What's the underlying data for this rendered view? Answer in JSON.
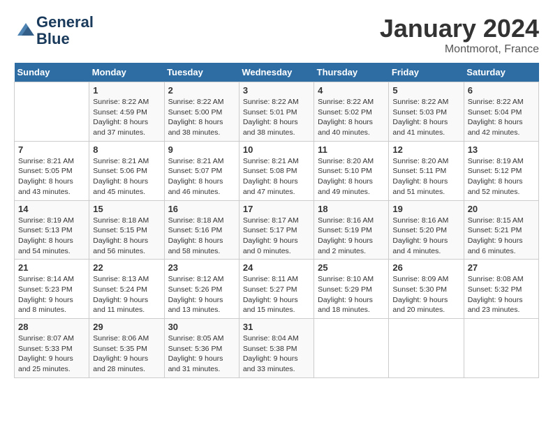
{
  "header": {
    "logo_line1": "General",
    "logo_line2": "Blue",
    "month_title": "January 2024",
    "location": "Montmorot, France"
  },
  "weekdays": [
    "Sunday",
    "Monday",
    "Tuesday",
    "Wednesday",
    "Thursday",
    "Friday",
    "Saturday"
  ],
  "weeks": [
    [
      {
        "day": "",
        "sunrise": "",
        "sunset": "",
        "daylight": ""
      },
      {
        "day": "1",
        "sunrise": "Sunrise: 8:22 AM",
        "sunset": "Sunset: 4:59 PM",
        "daylight": "Daylight: 8 hours and 37 minutes."
      },
      {
        "day": "2",
        "sunrise": "Sunrise: 8:22 AM",
        "sunset": "Sunset: 5:00 PM",
        "daylight": "Daylight: 8 hours and 38 minutes."
      },
      {
        "day": "3",
        "sunrise": "Sunrise: 8:22 AM",
        "sunset": "Sunset: 5:01 PM",
        "daylight": "Daylight: 8 hours and 38 minutes."
      },
      {
        "day": "4",
        "sunrise": "Sunrise: 8:22 AM",
        "sunset": "Sunset: 5:02 PM",
        "daylight": "Daylight: 8 hours and 40 minutes."
      },
      {
        "day": "5",
        "sunrise": "Sunrise: 8:22 AM",
        "sunset": "Sunset: 5:03 PM",
        "daylight": "Daylight: 8 hours and 41 minutes."
      },
      {
        "day": "6",
        "sunrise": "Sunrise: 8:22 AM",
        "sunset": "Sunset: 5:04 PM",
        "daylight": "Daylight: 8 hours and 42 minutes."
      }
    ],
    [
      {
        "day": "7",
        "sunrise": "Sunrise: 8:21 AM",
        "sunset": "Sunset: 5:05 PM",
        "daylight": "Daylight: 8 hours and 43 minutes."
      },
      {
        "day": "8",
        "sunrise": "Sunrise: 8:21 AM",
        "sunset": "Sunset: 5:06 PM",
        "daylight": "Daylight: 8 hours and 45 minutes."
      },
      {
        "day": "9",
        "sunrise": "Sunrise: 8:21 AM",
        "sunset": "Sunset: 5:07 PM",
        "daylight": "Daylight: 8 hours and 46 minutes."
      },
      {
        "day": "10",
        "sunrise": "Sunrise: 8:21 AM",
        "sunset": "Sunset: 5:08 PM",
        "daylight": "Daylight: 8 hours and 47 minutes."
      },
      {
        "day": "11",
        "sunrise": "Sunrise: 8:20 AM",
        "sunset": "Sunset: 5:10 PM",
        "daylight": "Daylight: 8 hours and 49 minutes."
      },
      {
        "day": "12",
        "sunrise": "Sunrise: 8:20 AM",
        "sunset": "Sunset: 5:11 PM",
        "daylight": "Daylight: 8 hours and 51 minutes."
      },
      {
        "day": "13",
        "sunrise": "Sunrise: 8:19 AM",
        "sunset": "Sunset: 5:12 PM",
        "daylight": "Daylight: 8 hours and 52 minutes."
      }
    ],
    [
      {
        "day": "14",
        "sunrise": "Sunrise: 8:19 AM",
        "sunset": "Sunset: 5:13 PM",
        "daylight": "Daylight: 8 hours and 54 minutes."
      },
      {
        "day": "15",
        "sunrise": "Sunrise: 8:18 AM",
        "sunset": "Sunset: 5:15 PM",
        "daylight": "Daylight: 8 hours and 56 minutes."
      },
      {
        "day": "16",
        "sunrise": "Sunrise: 8:18 AM",
        "sunset": "Sunset: 5:16 PM",
        "daylight": "Daylight: 8 hours and 58 minutes."
      },
      {
        "day": "17",
        "sunrise": "Sunrise: 8:17 AM",
        "sunset": "Sunset: 5:17 PM",
        "daylight": "Daylight: 9 hours and 0 minutes."
      },
      {
        "day": "18",
        "sunrise": "Sunrise: 8:16 AM",
        "sunset": "Sunset: 5:19 PM",
        "daylight": "Daylight: 9 hours and 2 minutes."
      },
      {
        "day": "19",
        "sunrise": "Sunrise: 8:16 AM",
        "sunset": "Sunset: 5:20 PM",
        "daylight": "Daylight: 9 hours and 4 minutes."
      },
      {
        "day": "20",
        "sunrise": "Sunrise: 8:15 AM",
        "sunset": "Sunset: 5:21 PM",
        "daylight": "Daylight: 9 hours and 6 minutes."
      }
    ],
    [
      {
        "day": "21",
        "sunrise": "Sunrise: 8:14 AM",
        "sunset": "Sunset: 5:23 PM",
        "daylight": "Daylight: 9 hours and 8 minutes."
      },
      {
        "day": "22",
        "sunrise": "Sunrise: 8:13 AM",
        "sunset": "Sunset: 5:24 PM",
        "daylight": "Daylight: 9 hours and 11 minutes."
      },
      {
        "day": "23",
        "sunrise": "Sunrise: 8:12 AM",
        "sunset": "Sunset: 5:26 PM",
        "daylight": "Daylight: 9 hours and 13 minutes."
      },
      {
        "day": "24",
        "sunrise": "Sunrise: 8:11 AM",
        "sunset": "Sunset: 5:27 PM",
        "daylight": "Daylight: 9 hours and 15 minutes."
      },
      {
        "day": "25",
        "sunrise": "Sunrise: 8:10 AM",
        "sunset": "Sunset: 5:29 PM",
        "daylight": "Daylight: 9 hours and 18 minutes."
      },
      {
        "day": "26",
        "sunrise": "Sunrise: 8:09 AM",
        "sunset": "Sunset: 5:30 PM",
        "daylight": "Daylight: 9 hours and 20 minutes."
      },
      {
        "day": "27",
        "sunrise": "Sunrise: 8:08 AM",
        "sunset": "Sunset: 5:32 PM",
        "daylight": "Daylight: 9 hours and 23 minutes."
      }
    ],
    [
      {
        "day": "28",
        "sunrise": "Sunrise: 8:07 AM",
        "sunset": "Sunset: 5:33 PM",
        "daylight": "Daylight: 9 hours and 25 minutes."
      },
      {
        "day": "29",
        "sunrise": "Sunrise: 8:06 AM",
        "sunset": "Sunset: 5:35 PM",
        "daylight": "Daylight: 9 hours and 28 minutes."
      },
      {
        "day": "30",
        "sunrise": "Sunrise: 8:05 AM",
        "sunset": "Sunset: 5:36 PM",
        "daylight": "Daylight: 9 hours and 31 minutes."
      },
      {
        "day": "31",
        "sunrise": "Sunrise: 8:04 AM",
        "sunset": "Sunset: 5:38 PM",
        "daylight": "Daylight: 9 hours and 33 minutes."
      },
      {
        "day": "",
        "sunrise": "",
        "sunset": "",
        "daylight": ""
      },
      {
        "day": "",
        "sunrise": "",
        "sunset": "",
        "daylight": ""
      },
      {
        "day": "",
        "sunrise": "",
        "sunset": "",
        "daylight": ""
      }
    ]
  ]
}
